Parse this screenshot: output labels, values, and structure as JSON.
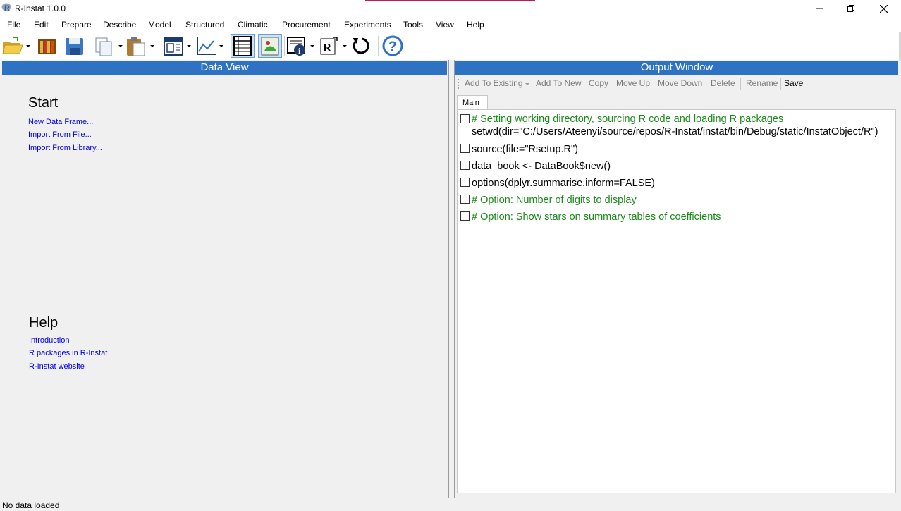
{
  "window": {
    "title": "R-Instat  1.0.0",
    "accent_color": "#c2185b"
  },
  "menu": [
    "File",
    "Edit",
    "Prepare",
    "Describe",
    "Model",
    "Structured",
    "Climatic",
    "Procurement",
    "Experiments",
    "Tools",
    "View",
    "Help"
  ],
  "toolbar": {
    "icons": [
      "open-folder-icon",
      "library-icon",
      "save-icon",
      "copy-icon",
      "paste-icon",
      "data-view-icon",
      "graph-icon",
      "grid-icon",
      "output-icon",
      "log-info-icon",
      "r-script-icon",
      "reset-icon",
      "help-icon"
    ]
  },
  "data_view": {
    "header": "Data View",
    "start_heading": "Start",
    "start_links": [
      "New Data Frame...",
      "Import From File...",
      "Import From Library..."
    ],
    "help_heading": "Help",
    "help_links": [
      "Introduction",
      "R packages in R-Instat",
      "R-Instat website"
    ]
  },
  "output_window": {
    "header": "Output Window",
    "actions": {
      "add_to_existing": "Add To Existing",
      "add_to_new": "Add To New",
      "copy": "Copy",
      "move_up": "Move Up",
      "move_down": "Move Down",
      "delete": "Delete",
      "rename": "Rename",
      "save": "Save"
    },
    "tab": "Main",
    "entries": [
      {
        "comment": "# Setting working directory, sourcing R code and loading R packages",
        "code": "setwd(dir=\"C:/Users/Ateenyi/source/repos/R-Instat/instat/bin/Debug/static/InstatObject/R\")"
      },
      {
        "code": "source(file=\"Rsetup.R\")"
      },
      {
        "code": "data_book <- DataBook$new()"
      },
      {
        "code": "options(dplyr.summarise.inform=FALSE)"
      },
      {
        "comment": "# Option: Number of digits to display"
      },
      {
        "comment": "# Option: Show stars on summary tables of coefficients"
      }
    ],
    "comment_color": "#1a8a1a"
  },
  "status": "No data loaded",
  "colors": {
    "header_blue": "#2e72c3",
    "link_blue": "#0000ee"
  }
}
